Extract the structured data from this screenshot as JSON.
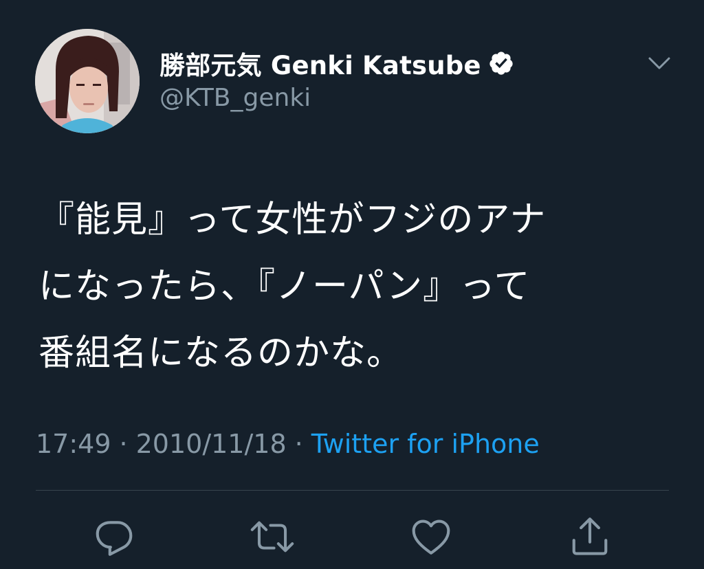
{
  "tweet": {
    "display_name": "勝部元気 Genki Katsube",
    "handle": "@KTB_genki",
    "verified": true,
    "text": "『能見』って女性がフジのアナ\nになったら、『ノーパン』って\n番組名になるのかな。",
    "time": "17:49",
    "date": "2010/11/18",
    "separator": "·",
    "source": "Twitter for iPhone"
  },
  "icons": {
    "menu": "chevron-down-icon",
    "verified": "verified-badge-icon",
    "reply": "reply-icon",
    "retweet": "retweet-icon",
    "like": "heart-icon",
    "share": "share-icon"
  },
  "colors": {
    "background": "#15202b",
    "text_primary": "#ffffff",
    "text_secondary": "#8899a6",
    "link": "#1da1f2",
    "divider": "#38444d"
  }
}
